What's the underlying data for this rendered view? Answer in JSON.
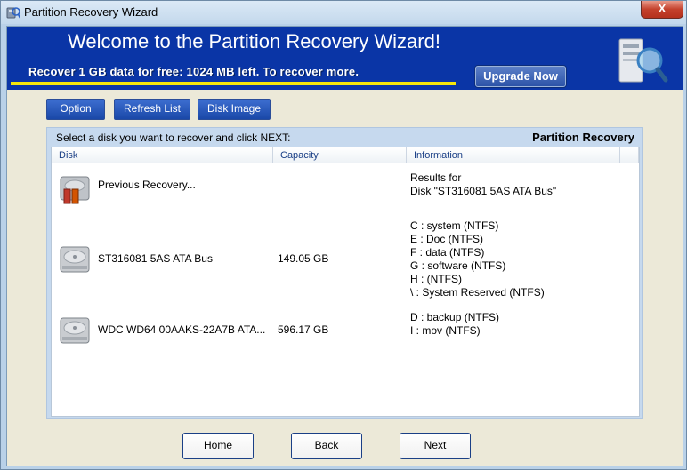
{
  "window": {
    "title": "Partition Recovery Wizard",
    "close_label": "X"
  },
  "banner": {
    "welcome": "Welcome to the Partition Recovery Wizard!",
    "promo": "Recover 1 GB data for free: 1024 MB left. To recover more.",
    "upgrade_label": "Upgrade Now",
    "colors": {
      "background": "#0a35a6",
      "accent_bar": "#f5e60a"
    }
  },
  "toolbar": {
    "option_label": "Option",
    "refresh_label": "Refresh List",
    "disk_image_label": "Disk Image"
  },
  "panel": {
    "hint": "Select a disk you want to recover and click NEXT:",
    "title": "Partition Recovery",
    "columns": [
      "Disk",
      "Capacity",
      "Information"
    ],
    "rows": [
      {
        "icon": "previous-recovery-icon",
        "disk": "Previous Recovery...",
        "capacity": "",
        "info": [
          "Results for",
          "Disk \"ST316081  5AS   ATA Bus\""
        ]
      },
      {
        "icon": "hard-disk-icon",
        "disk": "ST316081  5AS   ATA Bus",
        "capacity": "149.05 GB",
        "info": [
          "C : system  (NTFS)",
          "E : Doc  (NTFS)",
          "F : data  (NTFS)",
          "G : software  (NTFS)",
          "H :   (NTFS)",
          "\\ : System Reserved  (NTFS)"
        ]
      },
      {
        "icon": "hard-disk-icon",
        "disk": "WDC WD64  00AAKS-22A7B   ATA...",
        "capacity": "596.17 GB",
        "info": [
          "D : backup  (NTFS)",
          "I : mov  (NTFS)"
        ]
      }
    ]
  },
  "nav": {
    "home_label": "Home",
    "back_label": "Back",
    "next_label": "Next"
  }
}
